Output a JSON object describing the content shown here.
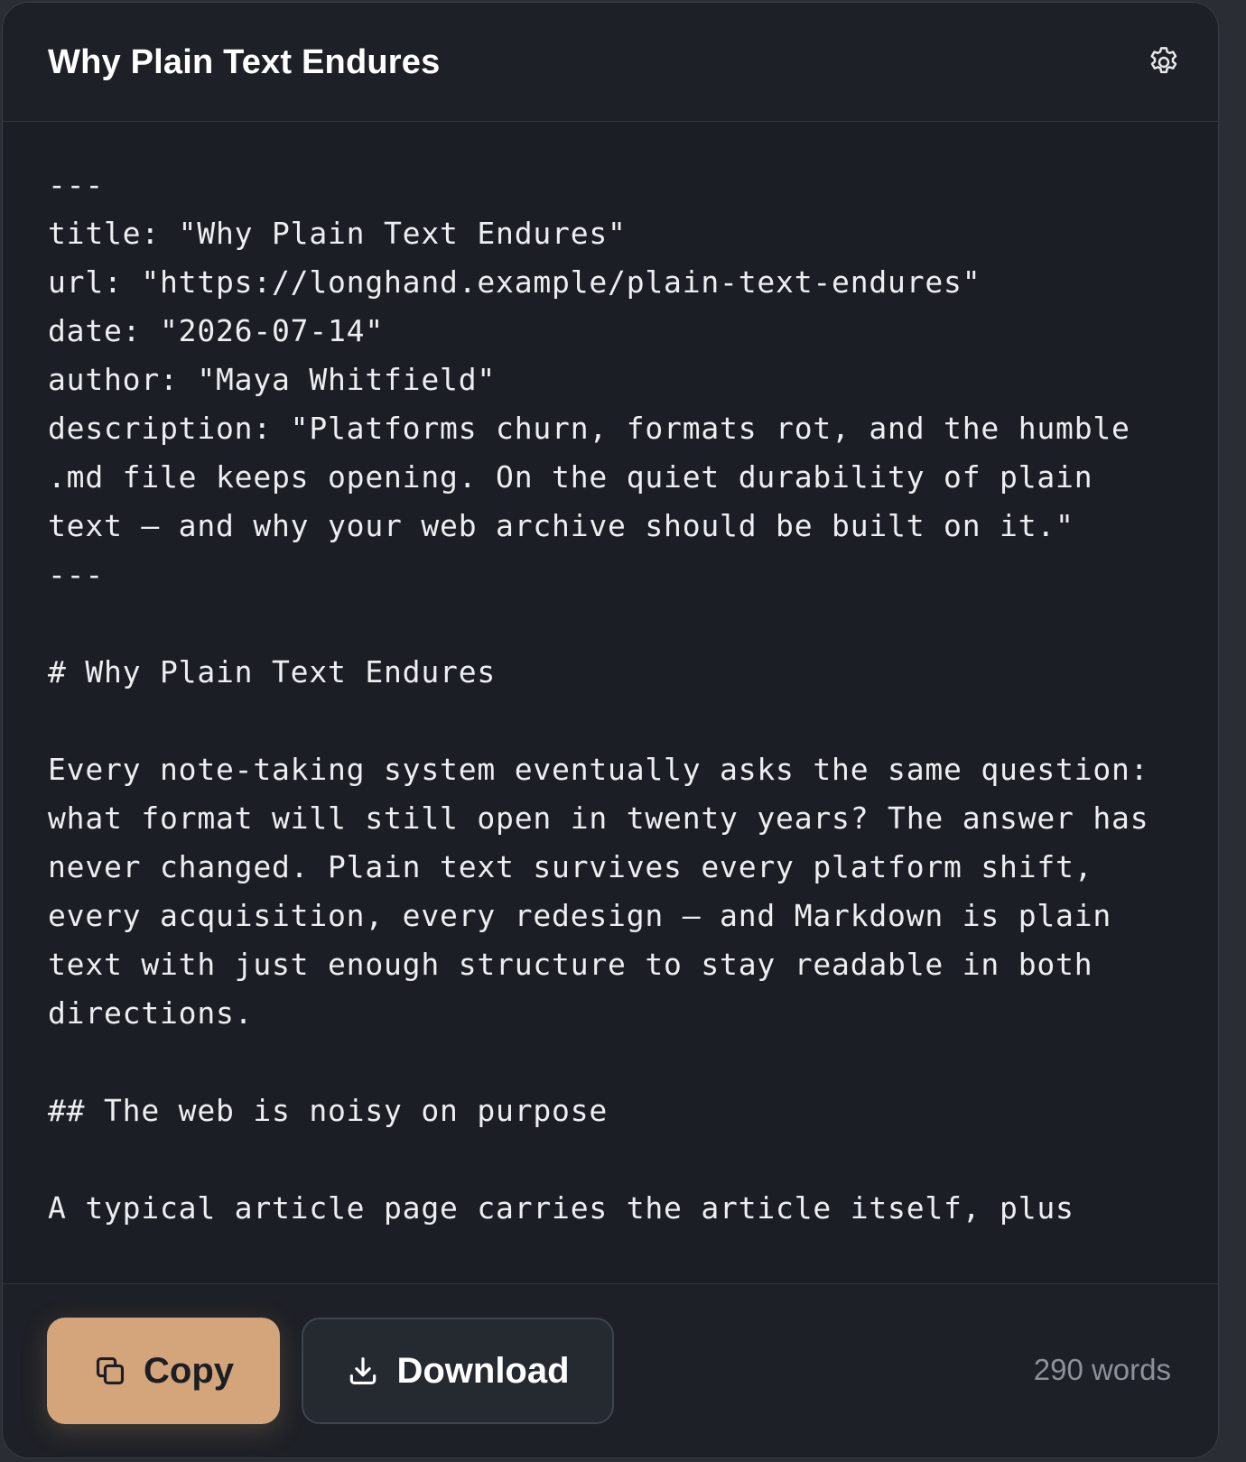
{
  "header": {
    "title": "Why Plain Text Endures",
    "settings_icon": "gear-icon"
  },
  "document": {
    "markdown": "---\ntitle: \"Why Plain Text Endures\"\nurl: \"https://longhand.example/plain-text-endures\"\ndate: \"2026-07-14\"\nauthor: \"Maya Whitfield\"\ndescription: \"Platforms churn, formats rot, and the humble .md file keeps opening. On the quiet durability of plain text — and why your web archive should be built on it.\"\n---\n\n# Why Plain Text Endures\n\nEvery note-taking system eventually asks the same question: what format will still open in twenty years? The answer has never changed. Plain text survives every platform shift, every acquisition, every redesign — and Markdown is plain text with just enough structure to stay readable in both directions.\n\n## The web is noisy on purpose\n\nA typical article page carries the article itself, plus"
  },
  "footer": {
    "copy_label": "Copy",
    "copy_icon": "copy-icon",
    "download_label": "Download",
    "download_icon": "download-icon",
    "word_count": "290 words"
  },
  "colors": {
    "accent": "#d4a57a",
    "background": "#1b1e24",
    "text": "#eceef1",
    "muted": "#8c919a"
  }
}
